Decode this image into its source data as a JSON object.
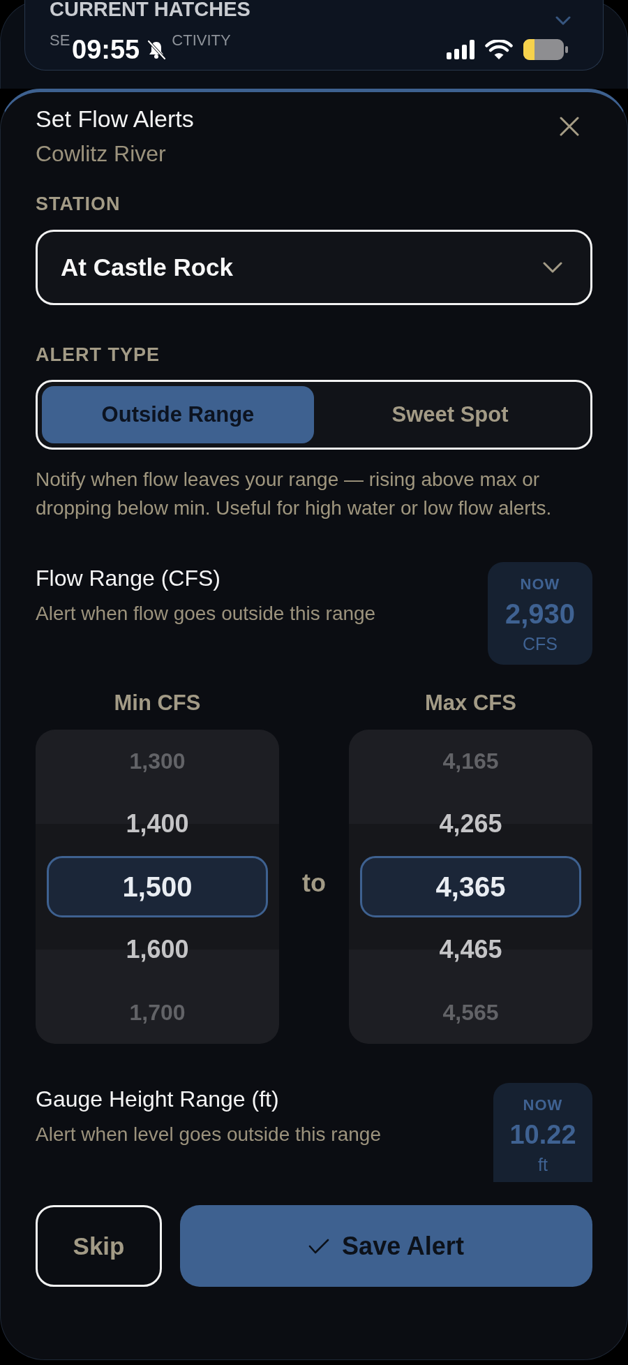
{
  "background": {
    "card_title": "CURRENT HATCHES",
    "card_subtitle_parts": [
      "SE",
      "CTIVITY"
    ]
  },
  "status_bar": {
    "time": "09:55"
  },
  "sheet": {
    "title": "Set Flow Alerts",
    "subtitle": "Cowlitz River"
  },
  "station": {
    "label": "STATION",
    "value": "At Castle Rock"
  },
  "alert_type": {
    "label": "ALERT TYPE",
    "options": [
      {
        "label": "Outside Range",
        "selected": true
      },
      {
        "label": "Sweet Spot",
        "selected": false
      }
    ],
    "description": "Notify when flow leaves your range — rising above max or dropping below min. Useful for high water or low flow alerts."
  },
  "flow_range": {
    "title": "Flow Range (CFS)",
    "subtitle": "Alert when flow goes outside this range",
    "now": {
      "label": "NOW",
      "value": "2,930",
      "unit": "CFS"
    },
    "pickers": [
      {
        "label": "Min CFS",
        "items": [
          {
            "value": "1,300",
            "selected": false
          },
          {
            "value": "1,400",
            "selected": false
          },
          {
            "value": "1,500",
            "selected": true
          },
          {
            "value": "1,600",
            "selected": false
          },
          {
            "value": "1,700",
            "selected": false
          }
        ]
      },
      {
        "label": "Max CFS",
        "items": [
          {
            "value": "4,165",
            "selected": false
          },
          {
            "value": "4,265",
            "selected": false
          },
          {
            "value": "4,365",
            "selected": true
          },
          {
            "value": "4,465",
            "selected": false
          },
          {
            "value": "4,565",
            "selected": false
          }
        ]
      }
    ],
    "separator": "to"
  },
  "gauge_range": {
    "title": "Gauge Height Range (ft)",
    "subtitle": "Alert when level goes outside this range",
    "now": {
      "label": "NOW",
      "value": "10.22",
      "unit": "ft"
    }
  },
  "buttons": [
    {
      "kind": "secondary",
      "label": "Skip"
    },
    {
      "kind": "primary",
      "label": "Save Alert"
    }
  ]
}
